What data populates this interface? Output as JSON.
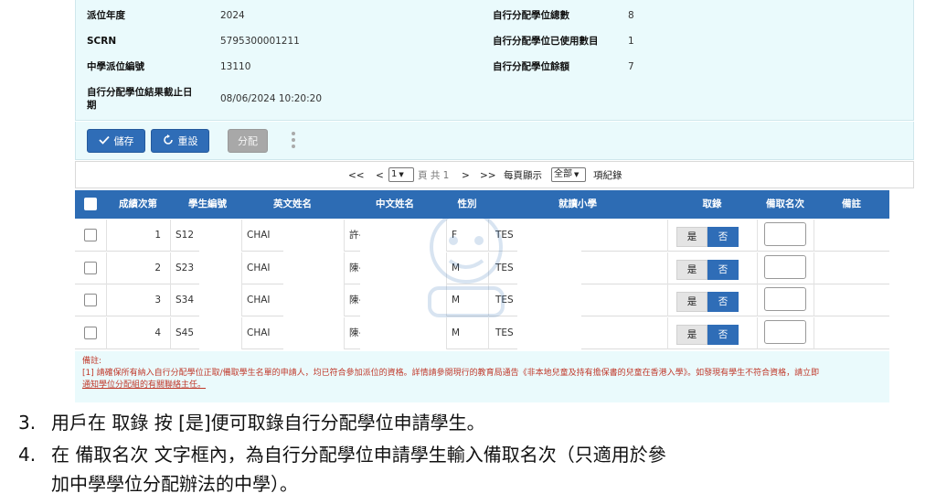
{
  "info": {
    "year_label": "派位年度",
    "year_value": "2024",
    "scrn_label": "SCRN",
    "scrn_value": "5795300001211",
    "school_no_label": "中學派位編號",
    "school_no_value": "13110",
    "deadline_label_1": "自行分配學位結果截止日",
    "deadline_label_2": "期",
    "deadline_value": "08/06/2024 10:20:20",
    "total_label": "自行分配學位總數",
    "total_value": "8",
    "used_label": "自行分配學位已使用數目",
    "used_value": "1",
    "remain_label": "自行分配學位餘額",
    "remain_value": "7"
  },
  "toolbar": {
    "save_label": "儲存",
    "reset_label": "重設",
    "allocate_label": "分配"
  },
  "pager": {
    "first": "<<",
    "prev": "<",
    "page": "1",
    "of_total": "頁 共 1",
    "next": ">",
    "last": ">>",
    "per_page_label": "每頁顯示",
    "per_page_value": "全部",
    "records_label": "項紀錄"
  },
  "table": {
    "headers": [
      "成績次第",
      "學生編號",
      "英文姓名",
      "中文姓名",
      "性別",
      "就讀小學",
      "取錄",
      "備取名次",
      "備註"
    ],
    "yes_label": "是",
    "no_label": "否",
    "rows": [
      {
        "rank": "1",
        "sid": "S12",
        "en": "CHAI",
        "zh": "許-",
        "gender": "F",
        "school": "TES"
      },
      {
        "rank": "2",
        "sid": "S23",
        "en": "CHAI",
        "zh": "陳-",
        "gender": "M",
        "school": "TES"
      },
      {
        "rank": "3",
        "sid": "S34",
        "en": "CHAI",
        "zh": "陳-",
        "gender": "M",
        "school": "TES"
      },
      {
        "rank": "4",
        "sid": "S45",
        "en": "CHAI",
        "zh": "陳-",
        "gender": "M",
        "school": "TES"
      }
    ]
  },
  "remarks": {
    "title": "備註:",
    "line1": "[1] 請確保所有納入自行分配學位正取/備取學生名單的申請人，均已符合參加派位的資格。詳情請參閱現行的教育局通告《非本地兒童及持有擔保書的兒童在香港入學》。如發現有學生不符合資格，請立即",
    "line2": "通知學位分配組的有關聯絡主任。"
  },
  "instructions": {
    "step3_num": "3.",
    "step3_text": "用戶在 取錄 按 [是]便可取錄自行分配學位申請學生。",
    "step4_num": "4.",
    "step4_text": "在 備取名次 文字框內，為自行分配學位申請學生輸入備取名次（只適用於參",
    "step4_cont": "加中學學位分配辦法的中學）。"
  },
  "colors": {
    "primary": "#2f6db7",
    "panel_bg": "#eafafc",
    "remark_red": "#c0392b"
  }
}
